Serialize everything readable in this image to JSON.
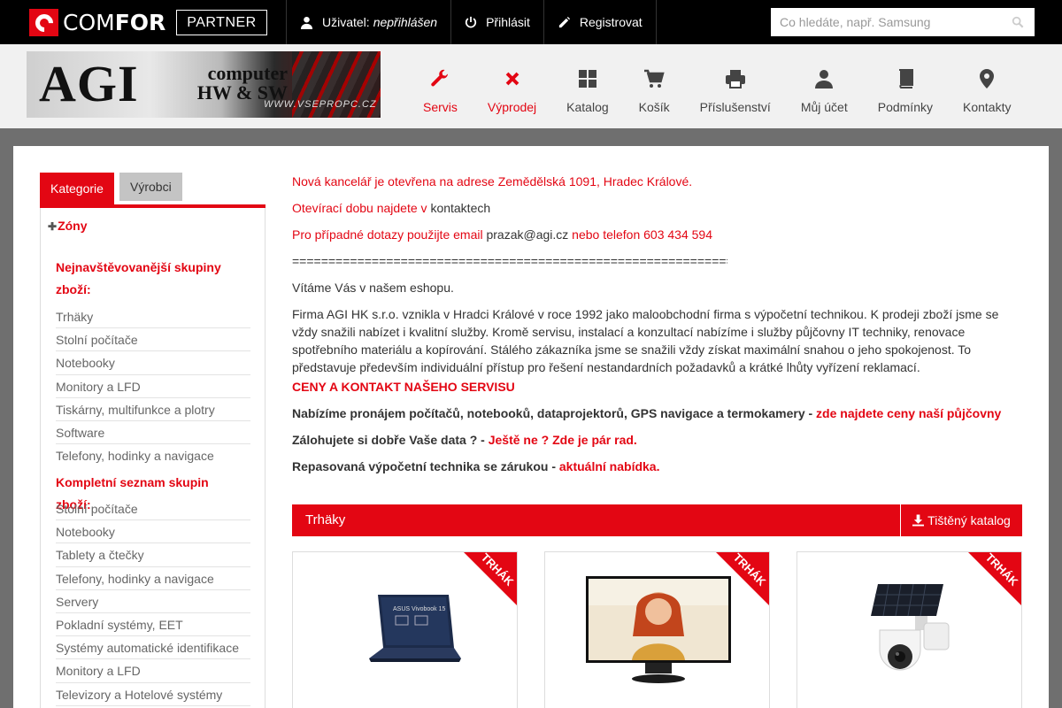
{
  "topbar": {
    "logo_text_light": "COM",
    "logo_text_bold": "FOR",
    "partner_label": "PARTNER",
    "user_label": "Uživatel:",
    "user_status": "nepřihlášen",
    "login_label": "Přihlásit",
    "register_label": "Registrovat",
    "search_placeholder": "Co hledáte, např. Samsung"
  },
  "banner": {
    "brand": "AGI",
    "sub_line1": "computer",
    "sub_line2": "HW & SW",
    "url": "WWW.VSEPROPC.CZ"
  },
  "mainnav": [
    {
      "label": "Servis",
      "icon": "wrench-icon",
      "active": true
    },
    {
      "label": "Výprodej",
      "icon": "x-icon",
      "active": true
    },
    {
      "label": "Katalog",
      "icon": "grid-icon",
      "active": false
    },
    {
      "label": "Košík",
      "icon": "cart-icon",
      "active": false
    },
    {
      "label": "Příslušenství",
      "icon": "printer-icon",
      "active": false
    },
    {
      "label": "Můj účet",
      "icon": "user-icon",
      "active": false
    },
    {
      "label": "Podmínky",
      "icon": "book-icon",
      "active": false
    },
    {
      "label": "Kontakty",
      "icon": "map-marker-icon",
      "active": false
    }
  ],
  "tabs": {
    "categories": "Kategorie",
    "manufacturers": "Výrobci"
  },
  "sidebar": {
    "zones": "Zóny",
    "most_visited_heading": "Nejnavštěvovanější skupiny zboží:",
    "most_visited": [
      "Trhäky",
      "Stolní počítače",
      "Notebooky",
      "Monitory a LFD",
      "Tiskárny, multifunkce a plotry",
      "Software",
      "Telefony, hodinky a navigace"
    ],
    "full_list_heading": "Kompletní seznam skupin zboží:",
    "full_list": [
      "Stolní počítače",
      "Notebooky",
      "Tablety a čtečky",
      "Telefony, hodinky a navigace",
      "Servery",
      "Pokladní systémy, EET",
      "Systémy automatické identifikace",
      "Monitory a LFD",
      "Televizory a Hotelové systémy"
    ]
  },
  "main": {
    "line1": "Nová kancelář je otevřena na adrese Zemědělská 1091, Hradec Králové.",
    "line2_prefix": "Otevírací dobu najdete v ",
    "line2_link": "kontaktech",
    "line3_prefix": "Pro případné dotazy použijte email ",
    "line3_email": "prazak@agi.cz",
    "line3_mid": " nebo telefon ",
    "line3_phone": "603 434 594",
    "separator": "=================================================================",
    "welcome": "Vítáme Vás v našem eshopu.",
    "about": "Firma AGI HK s.r.o. vznikla v Hradci Králové v roce 1992 jako maloobchodní firma s výpočetní technikou. K prodeji zboží jsme se vždy snažili nabízet i kvalitní služby. Kromě servisu, instalací a konzultací nabízíme i služby půjčovny IT techniky, renovace spotřebního materiálu a kopírování. Stálého zákazníka jsme se snažili vždy získat maximální snahou o jeho spokojenost. To představuje především individuální přístup pro řešení nestandardních požadavků a krátké lhůty vyřízení reklamací.",
    "service_link": "CENY A KONTAKT NAŠEHO SERVISU",
    "rental_text": "Nabízíme pronájem počítačů, notebooků, dataprojektorů, GPS navigace a termokamery - ",
    "rental_link": "zde najdete ceny naší půjčovny",
    "backup_text": "Zálohujete si dobře Vaše data ? - ",
    "backup_link": "Ještě ne ? Zde je pár rad.",
    "refurb_text": "Repasovaná výpočetní technika se zárukou - ",
    "refurb_link": "aktuální nabídka."
  },
  "section": {
    "title": "Trhäky",
    "catalog_label": "Tištěný katalog"
  },
  "products": [
    {
      "ribbon": "TRHÁK",
      "image": "laptop-image",
      "screen_text": "ASUS Vivobook 15"
    },
    {
      "ribbon": "TRHÁK",
      "image": "monitor-image"
    },
    {
      "ribbon": "TRHÁK",
      "image": "solar-camera-image"
    }
  ],
  "colors": {
    "accent": "#e30613",
    "topbar": "#000000",
    "header": "#f1f1f1",
    "page_bg": "#6f6f6f"
  }
}
